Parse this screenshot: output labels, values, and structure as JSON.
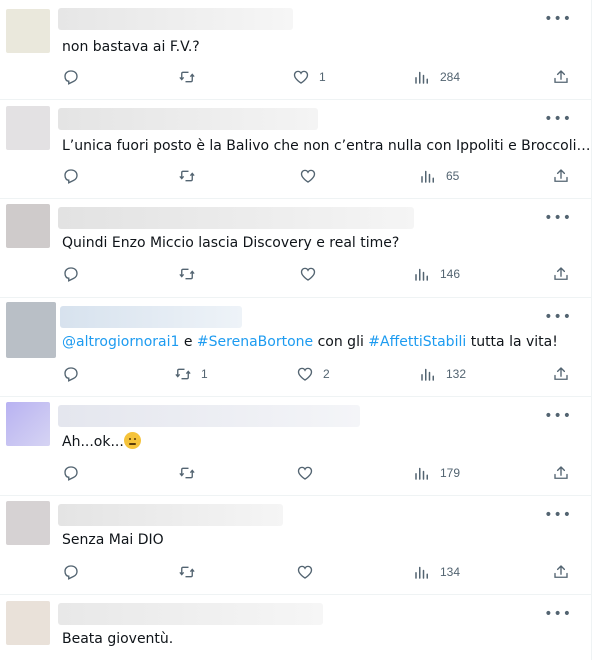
{
  "tweets": [
    {
      "text": "non bastava ai F.V.?",
      "replies": "",
      "retweets": "",
      "likes": "1",
      "views": "284",
      "avatar_color": "#eae8dc",
      "name_color": "#ececec"
    },
    {
      "text": "L’unica fuori posto è la Balivo che non c’entra nulla con Ippoliti e Broccoli…",
      "replies": "",
      "retweets": "",
      "likes": "",
      "views": "65",
      "avatar_color": "#e3e1e3",
      "name_color": "#e9e9e9"
    },
    {
      "text": "Quindi Enzo Miccio lascia Discovery e real time?",
      "replies": "",
      "retweets": "",
      "likes": "",
      "views": "146",
      "avatar_color": "#cfcbcb",
      "name_color": "#e6e6e6"
    },
    {
      "segments": [
        {
          "text": "@altrogiornorai1",
          "link": true
        },
        {
          "text": " e ",
          "link": false
        },
        {
          "text": "#SerenaBortone",
          "link": true
        },
        {
          "text": " con gli ",
          "link": false
        },
        {
          "text": "#AffettiStabili",
          "link": true
        },
        {
          "text": " tutta la vita!",
          "link": false
        }
      ],
      "replies": "",
      "retweets": "1",
      "likes": "2",
      "views": "132",
      "avatar_color": "#b9bfc6",
      "name_color": "#dfe6ee"
    },
    {
      "text": "Ah...ok...",
      "emoji": "slightly-frowning-face",
      "replies": "",
      "retweets": "",
      "likes": "",
      "views": "179",
      "avatar_color": "#c7c4f0",
      "name_color": "#eceef3"
    },
    {
      "text": "Senza Mai DIO",
      "replies": "",
      "retweets": "",
      "likes": "",
      "views": "134",
      "avatar_color": "#d6d2d3",
      "name_color": "#ececec"
    },
    {
      "text": "Beata gioventù.",
      "replies": "",
      "retweets": "",
      "likes": "",
      "views": "",
      "avatar_color": "#e9e1d9",
      "name_color": "#efefef"
    }
  ],
  "icons": {
    "more": "more-dots-icon",
    "reply": "reply-icon",
    "retweet": "retweet-icon",
    "like": "heart-icon",
    "views": "views-chart-icon",
    "share": "share-icon"
  },
  "colors": {
    "icon": "#536471",
    "link": "#1d9bf0",
    "text": "#0f1419",
    "divider": "#eff3f4"
  }
}
